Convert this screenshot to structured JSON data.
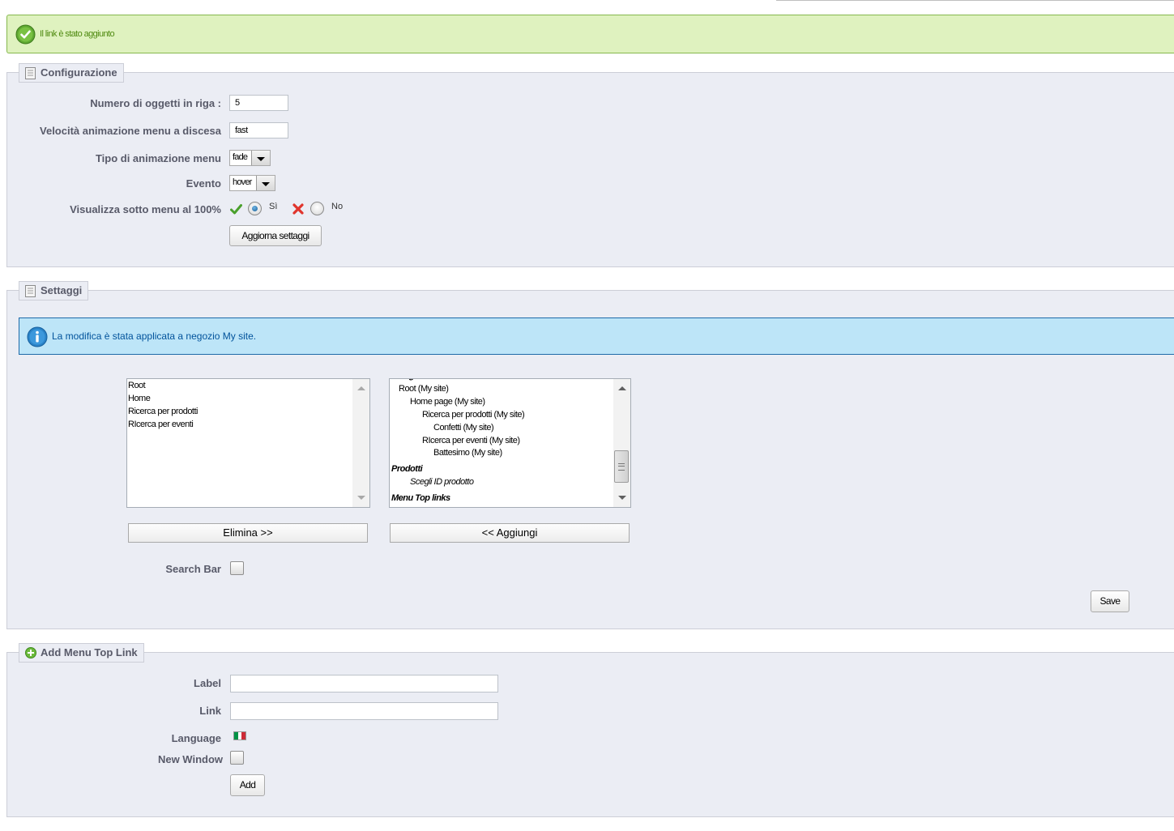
{
  "success_message": "Il link è stato aggiunto",
  "configuration": {
    "legend": "Configurazione",
    "fields": {
      "items_per_row": {
        "label": "Numero di oggetti in riga :",
        "value": "5"
      },
      "animation_speed": {
        "label": "Velocità animazione menu a discesa",
        "value": "fast"
      },
      "animation_type": {
        "label": "Tipo di animazione menu",
        "value": "fade"
      },
      "event": {
        "label": "Evento",
        "value": "hover"
      },
      "full_submenu": {
        "label": "Visualizza sotto menu al 100%",
        "yes_label": "Sì",
        "no_label": "No",
        "selected": "yes"
      }
    },
    "update_button": "Aggiorna settaggi"
  },
  "settings": {
    "legend": "Settaggi",
    "info_message": "La modifica è stata applicata a negozio My site.",
    "selected_items": [
      "Root",
      "Home",
      "Ricerca per prodotti",
      "RIcerca per eventi"
    ],
    "available_items": [
      {
        "text": "Categorie",
        "style": "group"
      },
      {
        "text": "Root (My site)",
        "style": "normal"
      },
      {
        "text": "Home page (My site)",
        "style": "normal"
      },
      {
        "text": "Ricerca per prodotti (My site)",
        "style": "normal"
      },
      {
        "text": "Confetti (My site)",
        "style": "normal"
      },
      {
        "text": "RIcerca per eventi (My site)",
        "style": "normal"
      },
      {
        "text": "Battesimo (My site)",
        "style": "normal"
      },
      {
        "text": "Prodotti",
        "style": "group"
      },
      {
        "text": "Scegli ID prodotto",
        "style": "italic"
      },
      {
        "text": "Menu Top links",
        "style": "group"
      }
    ],
    "remove_button": "Elimina >>",
    "add_button": "<< Aggiungi",
    "search_bar_label": "Search Bar",
    "search_bar_checked": false,
    "save_button": "Save"
  },
  "add_link": {
    "legend": "Add Menu Top Link",
    "label_label": "Label",
    "label_value": "",
    "link_label": "Link",
    "link_value": "",
    "language_label": "Language",
    "language_flag_colors": [
      "#009246",
      "#ffffff",
      "#ce2b37"
    ],
    "new_window_label": "New Window",
    "new_window_checked": false,
    "add_button": "Add"
  },
  "colors": {
    "success_bg": "#dff2bf",
    "success_text": "#4f8a10",
    "info_bg": "#bde5f8",
    "info_text": "#00529b",
    "panel_bg": "#ebedf4",
    "label_text": "#585a69"
  }
}
